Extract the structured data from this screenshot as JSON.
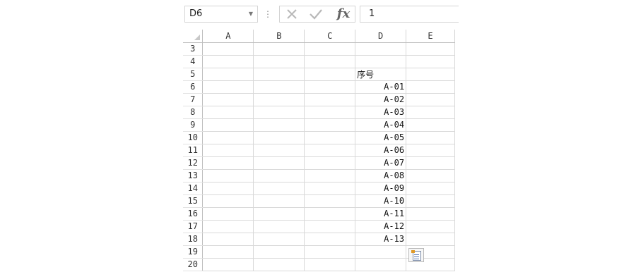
{
  "formula_bar": {
    "name_box": "D6",
    "formula_value": "1",
    "cancel_icon": "x-icon",
    "enter_icon": "check-icon",
    "function_icon": "fx-icon",
    "fx_label": "fx"
  },
  "columns": [
    "A",
    "B",
    "C",
    "D",
    "E"
  ],
  "rows": [
    {
      "num": "3",
      "A": "",
      "B": "",
      "C": "",
      "D": "",
      "E": ""
    },
    {
      "num": "4",
      "A": "",
      "B": "",
      "C": "",
      "D": "",
      "E": ""
    },
    {
      "num": "5",
      "A": "",
      "B": "",
      "C": "",
      "D": "序号",
      "E": ""
    },
    {
      "num": "6",
      "A": "",
      "B": "",
      "C": "",
      "D": "A-01",
      "E": ""
    },
    {
      "num": "7",
      "A": "",
      "B": "",
      "C": "",
      "D": "A-02",
      "E": ""
    },
    {
      "num": "8",
      "A": "",
      "B": "",
      "C": "",
      "D": "A-03",
      "E": ""
    },
    {
      "num": "9",
      "A": "",
      "B": "",
      "C": "",
      "D": "A-04",
      "E": ""
    },
    {
      "num": "10",
      "A": "",
      "B": "",
      "C": "",
      "D": "A-05",
      "E": ""
    },
    {
      "num": "11",
      "A": "",
      "B": "",
      "C": "",
      "D": "A-06",
      "E": ""
    },
    {
      "num": "12",
      "A": "",
      "B": "",
      "C": "",
      "D": "A-07",
      "E": ""
    },
    {
      "num": "13",
      "A": "",
      "B": "",
      "C": "",
      "D": "A-08",
      "E": ""
    },
    {
      "num": "14",
      "A": "",
      "B": "",
      "C": "",
      "D": "A-09",
      "E": ""
    },
    {
      "num": "15",
      "A": "",
      "B": "",
      "C": "",
      "D": "A-10",
      "E": ""
    },
    {
      "num": "16",
      "A": "",
      "B": "",
      "C": "",
      "D": "A-11",
      "E": ""
    },
    {
      "num": "17",
      "A": "",
      "B": "",
      "C": "",
      "D": "A-12",
      "E": ""
    },
    {
      "num": "18",
      "A": "",
      "B": "",
      "C": "",
      "D": "A-13",
      "E": ""
    },
    {
      "num": "19",
      "A": "",
      "B": "",
      "C": "",
      "D": "",
      "E": ""
    },
    {
      "num": "20",
      "A": "",
      "B": "",
      "C": "",
      "D": "",
      "E": ""
    }
  ],
  "header_cell": {
    "row": "5",
    "col": "D"
  },
  "autofill_options_icon": "auto-fill-options-icon"
}
